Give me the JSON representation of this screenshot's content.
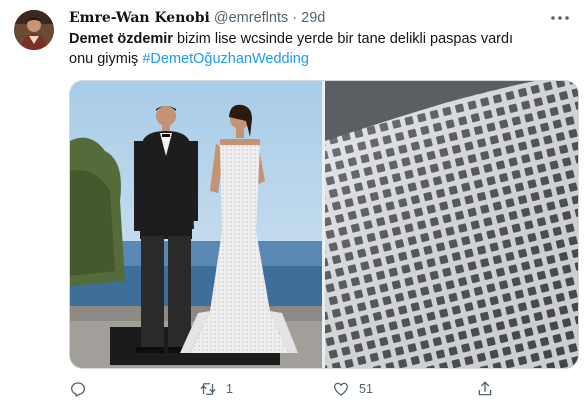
{
  "tweet": {
    "author_name": "Emre-Wan Kenobi",
    "handle": "@emreflnts",
    "separator": "·",
    "time": "29d",
    "text_bold": "Demet özdemir",
    "text_rest": " bizim lise wcsinde yerde bir tane delikli paspas vardı onu giymiş ",
    "hashtag": "#DemetOğuzhanWedding"
  },
  "actions": {
    "reply_count": "",
    "retweet_count": "1",
    "like_count": "51"
  },
  "icons": [
    "more-icon",
    "reply-icon",
    "retweet-icon",
    "like-icon",
    "share-icon"
  ],
  "colors": {
    "link": "#1d9bf0",
    "secondary_text": "#536471",
    "border": "#cfd9de"
  }
}
